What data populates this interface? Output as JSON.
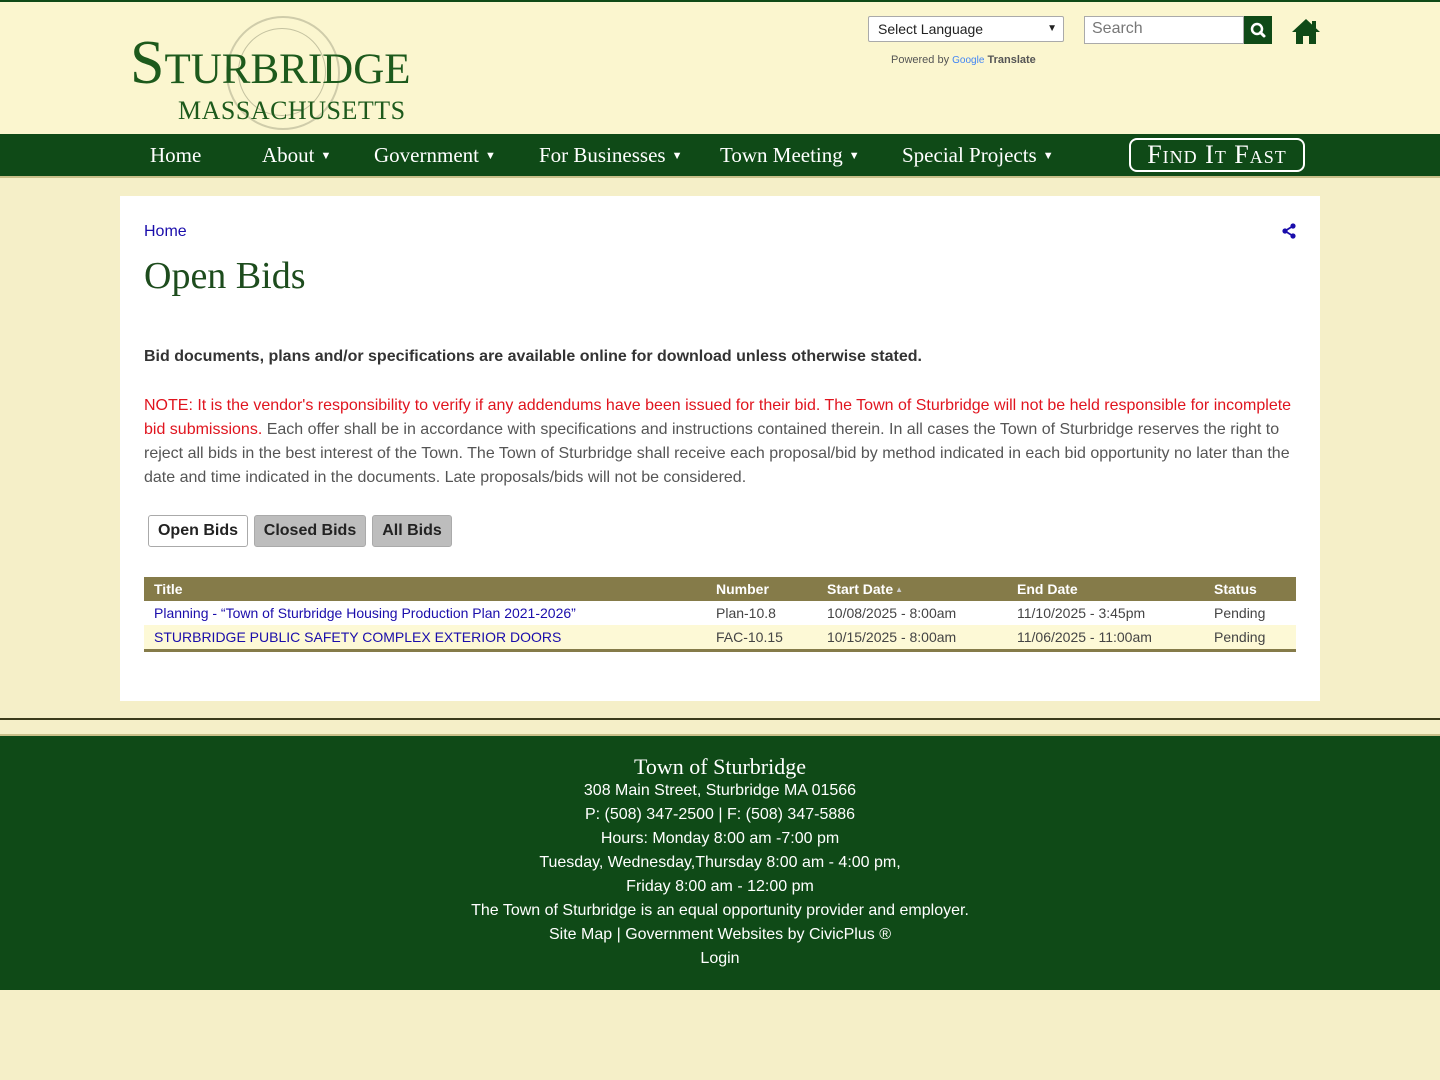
{
  "header": {
    "logo_title": "Sturbridge",
    "logo_subtitle": "MASSACHUSETTS",
    "language_select": "Select Language",
    "powered_by": "Powered by",
    "google": "Google",
    "translate": "Translate",
    "search_placeholder": "Search"
  },
  "nav": {
    "items": [
      "Home",
      "About",
      "Government",
      "For Businesses",
      "Town Meeting",
      "Special Projects"
    ],
    "find_it_fast": "Find It Fast"
  },
  "main": {
    "breadcrumb": "Home",
    "title": "Open Bids",
    "intro": "Bid documents, plans and/or specifications are available online for download unless otherwise stated.",
    "note_red": "NOTE: It is the vendor's responsibility to verify if any addendums have been issued for their bid.  The Town of Sturbridge will not be held responsible for incomplete bid submissions.",
    "note_rest": " Each offer shall be in accordance with specifications and instructions contained therein. In all cases the Town of Sturbridge reserves the right to reject all bids in the best interest of the Town.  The Town of Sturbridge shall receive each proposal/bid by method indicated in each bid opportunity no later than the date and time indicated in the documents. Late proposals/bids will not be considered.",
    "tabs": [
      "Open Bids",
      "Closed Bids",
      "All Bids"
    ],
    "table": {
      "headers": [
        "Title",
        "Number",
        "Start Date",
        "End Date",
        "Status"
      ],
      "rows": [
        [
          "Planning - “Town of Sturbridge Housing Production Plan 2021-2026”",
          "Plan-10.8",
          "10/08/2025 - 8:00am",
          "11/10/2025 - 3:45pm",
          "Pending"
        ],
        [
          "STURBRIDGE PUBLIC SAFETY COMPLEX EXTERIOR DOORS",
          "FAC-10.15",
          "10/15/2025 - 8:00am",
          "11/06/2025 - 11:00am",
          "Pending"
        ]
      ]
    }
  },
  "footer": {
    "title": "Town of Sturbridge",
    "lines": [
      "308 Main Street, Sturbridge MA 01566",
      "P: (508) 347-2500 | F: (508) 347-5886",
      "Hours: Monday 8:00 am -7:00 pm",
      "Tuesday, Wednesday,Thursday 8:00 am - 4:00 pm,",
      "Friday 8:00 am - 12:00 pm",
      "The Town of Sturbridge is an equal opportunity provider and employer.",
      "Site Map | Government Websites by CivicPlus ®",
      "Login"
    ]
  },
  "colors": {
    "primary_green": "#0f4a17",
    "cream": "#fbf6cf",
    "table_header": "#857b49",
    "link": "#1a0dab",
    "note_red": "#e0141e"
  }
}
